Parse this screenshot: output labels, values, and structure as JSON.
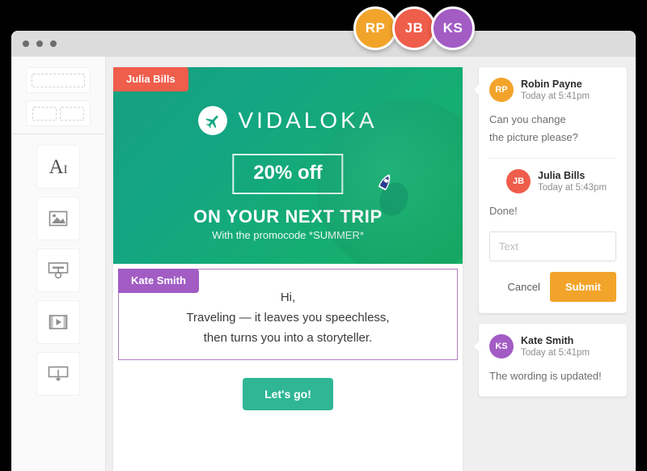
{
  "colors": {
    "orange": "#f2a42a",
    "red": "#ef5d4b",
    "purple": "#a25cc4",
    "green": "#2fb694",
    "teal_dark": "#17a07f",
    "teal_bright": "#17b267"
  },
  "collaborators": [
    {
      "initials": "RP",
      "color": "#f2a42a",
      "name": "Robin Payne"
    },
    {
      "initials": "JB",
      "color": "#ef5d4b",
      "name": "Julia Bills"
    },
    {
      "initials": "KS",
      "color": "#a25cc4",
      "name": "Kate Smith"
    }
  ],
  "sidebar": {
    "layout_blocks": [
      {
        "name": "one-column-layout",
        "columns": 1
      },
      {
        "name": "two-column-layout",
        "columns": 2
      }
    ],
    "tools": [
      {
        "name": "text-tool",
        "label": "AI",
        "glyph": "A"
      },
      {
        "name": "image-tool",
        "label": "Image"
      },
      {
        "name": "button-tool",
        "label": "Button"
      },
      {
        "name": "video-tool",
        "label": "Video"
      },
      {
        "name": "divider-tool",
        "label": "Divider"
      }
    ]
  },
  "canvas": {
    "hero": {
      "editor_tag": "Julia Bills",
      "editor_tag_color": "#ef5d4b",
      "brand": "VIDALOKA",
      "offer": "20% off",
      "headline": "ON YOUR NEXT TRIP",
      "subline": "With the promocode *SUMMER*"
    },
    "text_block": {
      "editor_tag": "Kate Smith",
      "editor_tag_color": "#a25cc4",
      "lines": [
        "Hi,",
        "Traveling — it leaves you speechless,",
        "then turns you into a storyteller."
      ]
    },
    "cta": {
      "label": "Let's go!",
      "color": "#2fb694"
    }
  },
  "comments": {
    "thread": {
      "messages": [
        {
          "initials": "RP",
          "color": "#f2a42a",
          "name": "Robin Payne",
          "time": "Today at 5:41pm",
          "text_line_1": "Can you change",
          "text_line_2": "the picture please?"
        },
        {
          "initials": "JB",
          "color": "#ef5d4b",
          "name": "Julia Bills",
          "time": "Today at 5:43pm",
          "text_line_1": "Done!"
        }
      ],
      "reply": {
        "value": "",
        "placeholder": "Text",
        "cancel_label": "Cancel",
        "submit_label": "Submit",
        "submit_color": "#f2a42a"
      }
    },
    "standalone": {
      "initials": "KS",
      "color": "#a25cc4",
      "name": "Kate Smith",
      "time": "Today at 5:41pm",
      "text_line_1": "The wording is updated!"
    }
  }
}
